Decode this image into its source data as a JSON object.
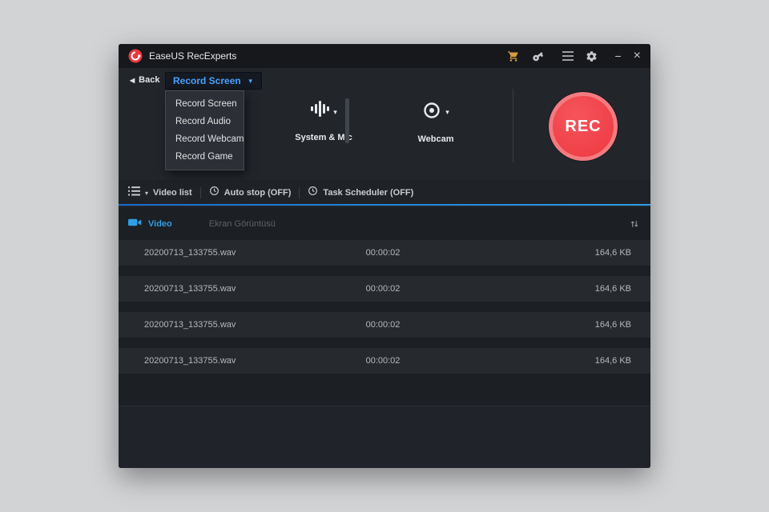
{
  "window": {
    "title": "EaseUS RecExperts",
    "controls": {
      "minimize": "−",
      "close": "×"
    }
  },
  "glyphs": {
    "back": "◀",
    "dropdown": "▼",
    "caret": "▾"
  },
  "topbar": {
    "back": "Back",
    "mode": {
      "selected": "Record Screen",
      "options": [
        "Record Screen",
        "Record Audio",
        "Record Webcam",
        "Record Game"
      ]
    },
    "system_mic": "System & Mic",
    "webcam": "Webcam",
    "rec": "REC"
  },
  "toolbar": {
    "video_list": "Video list",
    "auto_stop": "Auto stop (OFF)",
    "task_scheduler": "Task Scheduler (OFF)"
  },
  "list": {
    "video_tab": "Video",
    "screenshot_tab": "Ekran Görüntüsü",
    "rows": [
      {
        "name": "20200713_133755.wav",
        "duration": "00:00:02",
        "size": "164,6 KB"
      },
      {
        "name": "20200713_133755.wav",
        "duration": "00:00:02",
        "size": "164,6 KB"
      },
      {
        "name": "20200713_133755.wav",
        "duration": "00:00:02",
        "size": "164,6 KB"
      },
      {
        "name": "20200713_133755.wav",
        "duration": "00:00:02",
        "size": "164,6 KB"
      }
    ]
  },
  "colors": {
    "accent_blue": "#2e9fe6",
    "rec_red": "#f23d44",
    "cart_gold": "#d89c3e"
  }
}
